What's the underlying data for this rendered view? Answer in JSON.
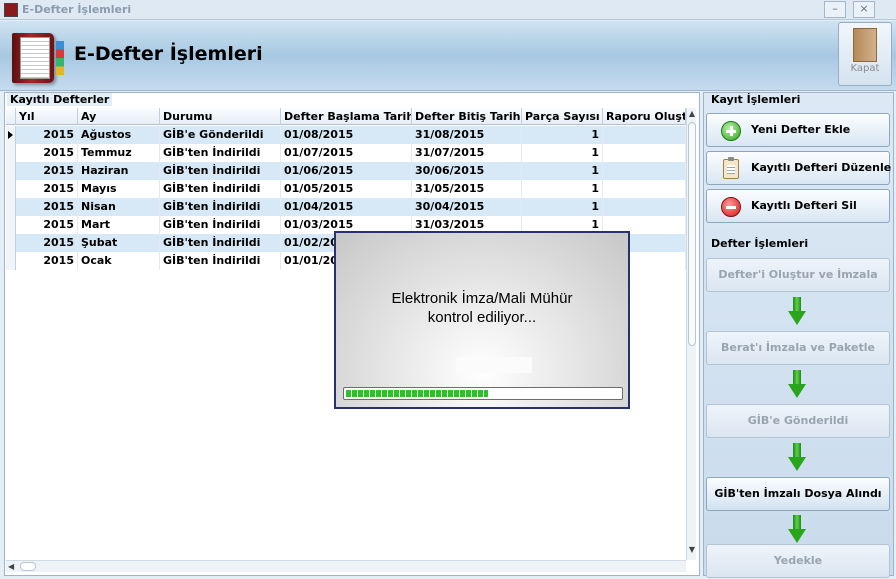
{
  "window": {
    "title": "E-Defter İşlemleri"
  },
  "header": {
    "title": "E-Defter İşlemleri",
    "close_label": "Kapat"
  },
  "grid": {
    "caption": "Kayıtlı Defterler",
    "columns": [
      "Yıl",
      "Ay",
      "Durumu",
      "Defter Başlama Tarihi",
      "Defter Bitiş Tarihi",
      "Parça Sayısı",
      "Raporu Oluştu"
    ],
    "rows": [
      [
        "2015",
        "Ağustos",
        "GİB'e Gönderildi",
        "01/08/2015",
        "31/08/2015",
        "1",
        ""
      ],
      [
        "2015",
        "Temmuz",
        "GİB'ten İndirildi",
        "01/07/2015",
        "31/07/2015",
        "1",
        ""
      ],
      [
        "2015",
        "Haziran",
        "GİB'ten İndirildi",
        "01/06/2015",
        "30/06/2015",
        "1",
        ""
      ],
      [
        "2015",
        "Mayıs",
        "GİB'ten İndirildi",
        "01/05/2015",
        "31/05/2015",
        "1",
        ""
      ],
      [
        "2015",
        "Nisan",
        "GİB'ten İndirildi",
        "01/04/2015",
        "30/04/2015",
        "1",
        ""
      ],
      [
        "2015",
        "Mart",
        "GİB'ten İndirildi",
        "01/03/2015",
        "31/03/2015",
        "1",
        ""
      ],
      [
        "2015",
        "Şubat",
        "GİB'ten İndirildi",
        "01/02/20",
        "",
        "",
        ""
      ],
      [
        "2015",
        "Ocak",
        "GİB'ten İndirildi",
        "01/01/20",
        "",
        "",
        ""
      ]
    ],
    "selected_row": 0
  },
  "kayit_islemleri": {
    "caption": "Kayıt İşlemleri",
    "add_label": "Yeni Defter Ekle",
    "edit_label": "Kayıtlı Defteri Düzenle",
    "delete_label": "Kayıtlı Defteri Sil"
  },
  "defter_islemleri": {
    "caption": "Defter İşlemleri",
    "steps": [
      {
        "label": "Defter'i Oluştur ve İmzala",
        "enabled": false
      },
      {
        "label": "Berat'ı İmzala ve Paketle",
        "enabled": false
      },
      {
        "label": "GİB'e Gönderildi",
        "enabled": false
      },
      {
        "label": "GİB'ten İmzalı Dosya Alındı",
        "enabled": true
      },
      {
        "label": "Yedekle",
        "enabled": false
      }
    ]
  },
  "dialog": {
    "line1": "Elektronik İmza/Mali Mühür",
    "line2": "kontrol ediliyor...",
    "progress": 0.52
  },
  "colors": {
    "row_alt": "#d7e9f7",
    "progress": "#2fc12a",
    "dialog_border": "#27316e"
  },
  "icons": [
    "app-icon",
    "book-logo-icon",
    "close-door-icon",
    "plus-icon",
    "clipboard-icon",
    "minus-icon",
    "down-arrow-icon",
    "row-pointer-icon"
  ]
}
